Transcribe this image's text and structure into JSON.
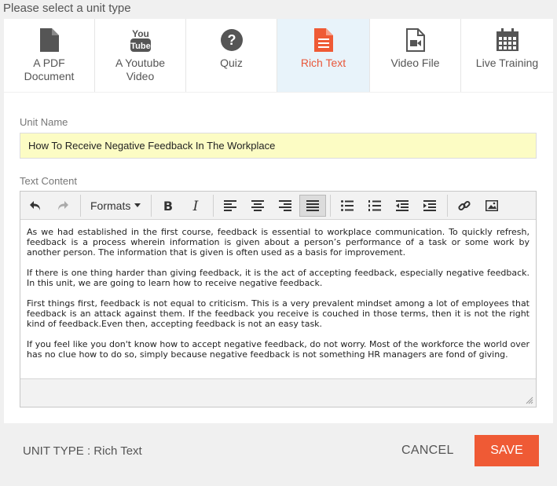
{
  "header": {
    "title": "Please select a unit type"
  },
  "tabs": [
    {
      "label_line1": "A PDF",
      "label_line2": "Document",
      "icon": "file-icon"
    },
    {
      "label_line1": "A Youtube",
      "label_line2": "Video",
      "icon": "youtube-icon"
    },
    {
      "label_line1": "Quiz",
      "label_line2": "",
      "icon": "question-circle-icon"
    },
    {
      "label_line1": "Rich Text",
      "label_line2": "",
      "icon": "file-text-icon",
      "active": true
    },
    {
      "label_line1": "Video File",
      "label_line2": "",
      "icon": "file-video-icon"
    },
    {
      "label_line1": "Live Training",
      "label_line2": "",
      "icon": "calendar-icon"
    }
  ],
  "form": {
    "unit_name_label": "Unit Name",
    "unit_name_value": "How To Receive Negative Feedback In The Workplace",
    "text_content_label": "Text Content"
  },
  "editor": {
    "formats_label": "Formats",
    "paragraphs": [
      "As we had established in the first course, feedback is essential to workplace communication. To quickly refresh, feedback is a process wherein information is given about a person’s performance of a task or some work by another person. The information that is given is often used as a basis for improvement.",
      "If there is one thing harder than giving feedback, it is the act of accepting feedback, especially negative feedback. In this unit, we are going to learn how to receive negative feedback.",
      "First things first, feedback is not equal to criticism. This is a very prevalent mindset among a lot of employees that feedback is an attack against them. If the feedback you receive is couched in those terms, then it is not the right kind of feedback.Even then, accepting feedback is not an easy task.",
      "If you feel like you don't know how to accept negative feedback, do not worry. Most of the workforce the world over has no clue how to do so, simply because negative feedback is not something HR managers are fond of giving."
    ]
  },
  "footer": {
    "unit_type_text": "UNIT TYPE : Rich Text",
    "cancel_label": "CANCEL",
    "save_label": "SAVE"
  },
  "colors": {
    "accent": "#ef5a35",
    "active_tab_bg": "#e8f3fa",
    "input_highlight": "#fcfcc4"
  }
}
